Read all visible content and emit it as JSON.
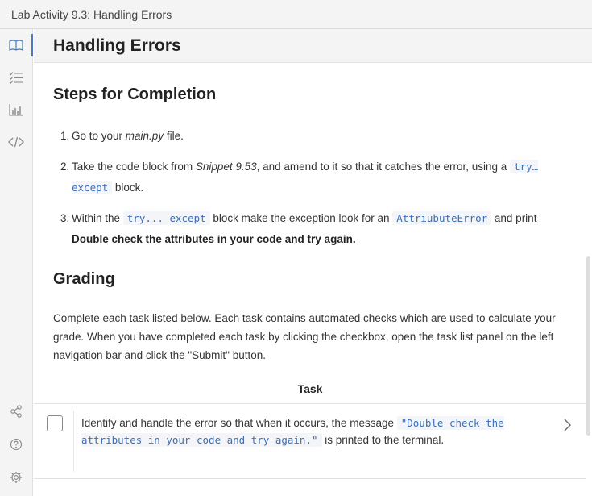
{
  "window": {
    "title": "Lab Activity 9.3: Handling Errors"
  },
  "sidebar": {
    "icons": [
      "book-icon",
      "checklist-icon",
      "bar-chart-icon",
      "code-icon",
      "share-icon",
      "help-icon",
      "settings-icon"
    ]
  },
  "header": {
    "title": "Handling Errors"
  },
  "steps_section": {
    "heading": "Steps for Completion",
    "items": [
      {
        "num": "1.",
        "parts": {
          "a": "Go to your ",
          "file": "main.py",
          "b": " file."
        }
      },
      {
        "num": "2.",
        "parts": {
          "a": "Take the code block from ",
          "snippet": "Snippet 9.53",
          "b": ", and amend to it so that it catches the error, using a ",
          "code": "try… except",
          "c": " block."
        }
      },
      {
        "num": "3.",
        "parts": {
          "a": "Within the ",
          "code1": "try... except",
          "b": " block make the exception look for an ",
          "code2": "AttriubuteError",
          "c": " and print ",
          "bold": "Double check the attributes in your code and try again."
        }
      }
    ]
  },
  "grading": {
    "heading": "Grading",
    "text": "Complete each task listed below. Each task contains automated checks which are used to calculate your grade. When you have completed each task by clicking the checkbox, open the task list panel on the left navigation bar and click the \"Submit\" button."
  },
  "tasks": {
    "header": "Task",
    "items": [
      {
        "checked": false,
        "text_a": "Identify and handle the error so that when it occurs, the message ",
        "code": "\"Double check the attributes in your code and try again.\"",
        "text_b": " is printed to the terminal."
      }
    ]
  },
  "colors": {
    "accent": "#4a78c4",
    "code_text": "#3b6fb6"
  }
}
